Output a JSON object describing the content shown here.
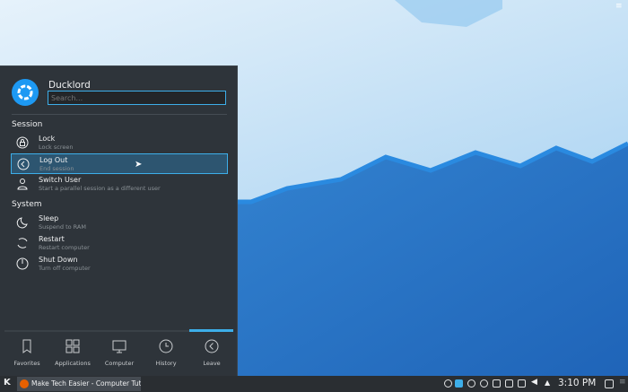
{
  "user": {
    "name": "Ducklord",
    "search_placeholder": "Search..."
  },
  "sections": {
    "session": "Session",
    "system": "System"
  },
  "items": [
    {
      "title": "Lock",
      "sub": "Lock screen"
    },
    {
      "title": "Log Out",
      "sub": "End session"
    },
    {
      "title": "Switch User",
      "sub": "Start a parallel session as a different user"
    },
    {
      "title": "Sleep",
      "sub": "Suspend to RAM"
    },
    {
      "title": "Restart",
      "sub": "Restart computer"
    },
    {
      "title": "Shut Down",
      "sub": "Turn off computer"
    }
  ],
  "tabs": [
    "Favorites",
    "Applications",
    "Computer",
    "History",
    "Leave"
  ],
  "taskbar": {
    "task": "Make Tech Easier - Computer Tut...",
    "clock": "3:10 PM"
  },
  "colors": {
    "accent": "#3daee9",
    "panel": "#2e343a"
  }
}
